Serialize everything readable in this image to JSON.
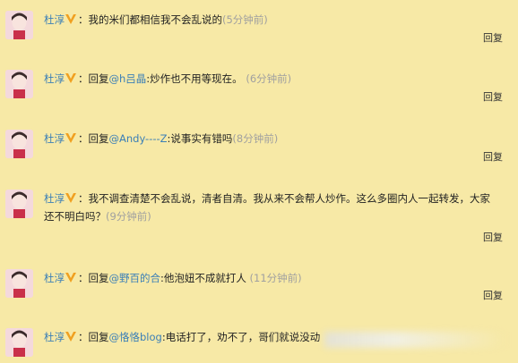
{
  "reply_label": "回复",
  "comments": [
    {
      "user": "杜淳",
      "prefix": "",
      "mention": "",
      "text": "我的米们都相信我不会乱说的",
      "time": "(5分钟前)"
    },
    {
      "user": "杜淳",
      "prefix": "回复",
      "mention": "@h吕晶",
      "text": ":炒作也不用等现在。",
      "time": "(6分钟前)"
    },
    {
      "user": "杜淳",
      "prefix": "回复",
      "mention": "@Andy----Z",
      "text": ":说事实有错吗",
      "time": "(8分钟前)"
    },
    {
      "user": "杜淳",
      "prefix": "",
      "mention": "",
      "text": "我不调查清楚不会乱说，清者自清。我从来不会帮人炒作。这么多圈内人一起转发，大家还不明白吗？",
      "time": "(9分钟前)"
    },
    {
      "user": "杜淳",
      "prefix": "回复",
      "mention": "@野百的合",
      "text": ":他泡妞不成就打人",
      "time": "(11分钟前)"
    },
    {
      "user": "杜淳",
      "prefix": "回复",
      "mention": "@恪恪blog",
      "text": ":电话打了，劝不了，哥们就说没动",
      "time": ""
    }
  ],
  "colors": {
    "background": "#f7e9a6",
    "link": "#3b7fb7",
    "vip": "#f0a020"
  }
}
